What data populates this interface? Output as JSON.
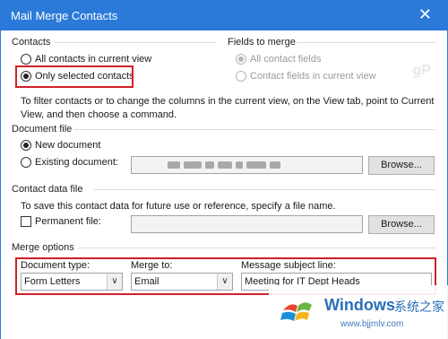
{
  "window": {
    "title": "Mail Merge Contacts",
    "close_icon": "close-icon"
  },
  "contacts": {
    "label": "Contacts",
    "options": [
      {
        "label": "All contacts in current view",
        "selected": false
      },
      {
        "label": "Only selected contacts",
        "selected": true
      }
    ]
  },
  "fields": {
    "label": "Fields to merge",
    "options": [
      {
        "label": "All contact fields",
        "selected": true
      },
      {
        "label": "Contact fields in current view",
        "selected": false
      }
    ]
  },
  "filter_hint": {
    "line1": "To filter contacts or to change the columns in the current view, on the View tab, point to Current",
    "line2": "View, and then choose a command."
  },
  "document_file": {
    "label": "Document file",
    "new_label": "New document",
    "existing_label": "Existing document:",
    "browse_label": "Browse..."
  },
  "contact_data_file": {
    "label": "Contact data file",
    "hint": "To save this contact data for future use or reference, specify a file name.",
    "permanent_label": "Permanent file:",
    "browse_label": "Browse..."
  },
  "merge_options": {
    "label": "Merge options",
    "document_type_label": "Document type:",
    "document_type_value": "Form Letters",
    "merge_to_label": "Merge to:",
    "merge_to_value": "Email",
    "subject_label": "Message subject line:",
    "subject_value": "Meeting for IT Dept Heads"
  },
  "watermark": {
    "site_mark": "gP",
    "brand": "Windows",
    "brand_cn": "系统之家",
    "url": "www.bjjmlv.com"
  },
  "colors": {
    "titlebar": "#2b79d8",
    "highlight": "#d0202b"
  }
}
